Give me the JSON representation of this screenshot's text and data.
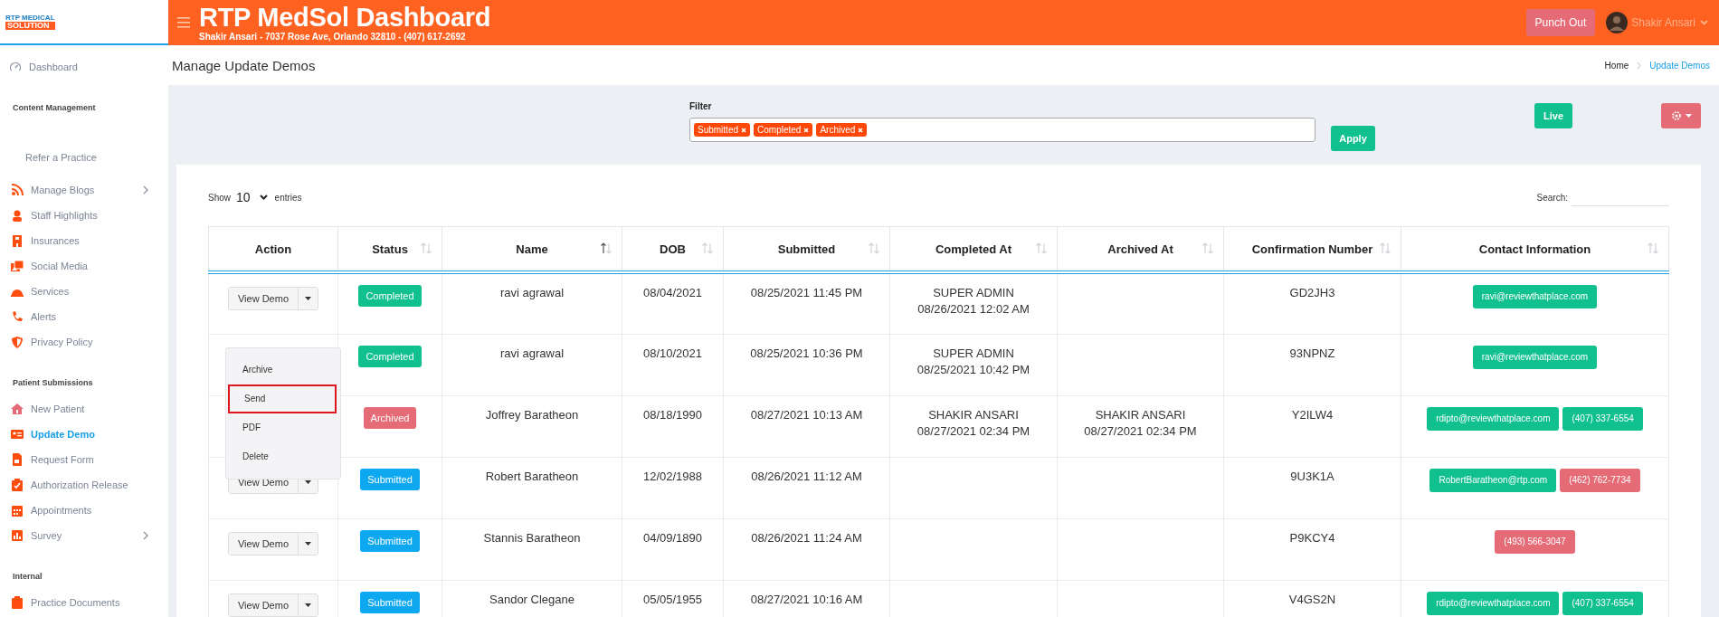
{
  "logo": {
    "line1": "RTP MEDICAL",
    "line2": "SOLUTION"
  },
  "header": {
    "title": "RTP MedSol Dashboard",
    "subtitle": "Shakir Ansari - 7037 Rose Ave, Orlando 32810 - (407) 617-2692",
    "punch_button": "Punch Out",
    "user_name": "Shakir Ansari"
  },
  "sidebar": {
    "sections": [
      {
        "items": [
          {
            "label": "Dashboard",
            "kind": "top",
            "selected": false,
            "has_submenu": false
          }
        ]
      },
      {
        "title": "Content Management",
        "items": [
          {
            "label": "Refer a Practice",
            "kind": "plain",
            "selected": false,
            "has_submenu": false
          },
          {
            "label": "Manage Blogs",
            "kind": "icon",
            "selected": false,
            "has_submenu": true
          },
          {
            "label": "Staff Highlights",
            "kind": "icon",
            "selected": false,
            "has_submenu": false
          },
          {
            "label": "Insurances",
            "kind": "icon",
            "selected": false,
            "has_submenu": false
          },
          {
            "label": "Social Media",
            "kind": "icon",
            "selected": false,
            "has_submenu": false
          },
          {
            "label": "Services",
            "kind": "icon",
            "selected": false,
            "has_submenu": false
          },
          {
            "label": "Alerts",
            "kind": "icon",
            "selected": false,
            "has_submenu": false
          },
          {
            "label": "Privacy Policy",
            "kind": "icon",
            "selected": false,
            "has_submenu": false
          }
        ]
      },
      {
        "title": "Patient Submissions",
        "items": [
          {
            "label": "New Patient",
            "kind": "icon",
            "selected": false,
            "has_submenu": false
          },
          {
            "label": "Update Demo",
            "kind": "icon",
            "selected": true,
            "has_submenu": false
          },
          {
            "label": "Request Form",
            "kind": "icon",
            "selected": false,
            "has_submenu": false
          },
          {
            "label": "Authorization Release",
            "kind": "icon",
            "selected": false,
            "has_submenu": false
          },
          {
            "label": "Appointments",
            "kind": "icon",
            "selected": false,
            "has_submenu": false
          },
          {
            "label": "Survey",
            "kind": "icon",
            "selected": false,
            "has_submenu": true
          }
        ]
      },
      {
        "title": "Internal",
        "items": [
          {
            "label": "Practice Documents",
            "kind": "icon",
            "selected": false,
            "has_submenu": false
          }
        ]
      }
    ]
  },
  "page": {
    "title": "Manage Update Demos",
    "breadcrumb": [
      {
        "label": "Home",
        "selected": false
      },
      {
        "label": "Update Demos",
        "selected": true
      }
    ]
  },
  "filter": {
    "label": "Filter",
    "tags": [
      "Submitted",
      "Completed",
      "Archived"
    ],
    "apply_button": "Apply",
    "live_button": "Live"
  },
  "table_controls": {
    "show_label": "Show",
    "page_size": "10",
    "entries_label": "entries",
    "search_label": "Search:"
  },
  "table": {
    "columns": [
      {
        "label": "Action",
        "sortable": false
      },
      {
        "label": "Status",
        "sortable": true,
        "sorted": false
      },
      {
        "label": "Name",
        "sortable": true,
        "sorted": true
      },
      {
        "label": "DOB",
        "sortable": true,
        "sorted": false
      },
      {
        "label": "Submitted",
        "sortable": true,
        "sorted": false
      },
      {
        "label": "Completed At",
        "sortable": true,
        "sorted": false
      },
      {
        "label": "Archived At",
        "sortable": true,
        "sorted": false
      },
      {
        "label": "Confirmation Number",
        "sortable": true,
        "sorted": false
      },
      {
        "label": "Contact Information",
        "sortable": true,
        "sorted": false
      }
    ],
    "rows": [
      {
        "action": {
          "button": "View Demo"
        },
        "status": {
          "label": "Completed",
          "kind": "completed"
        },
        "name": "ravi agrawal",
        "dob": "08/04/2021",
        "submitted": "08/25/2021 11:45 PM",
        "completed_at": [
          "SUPER ADMIN",
          "08/26/2021 12:02 AM"
        ],
        "confirmation": "GD2JH3",
        "contacts": [
          {
            "text": "ravi@reviewthatplace.com",
            "color": "#10c08e"
          }
        ]
      },
      {
        "action": {
          "menu": [
            {
              "label": "Archive",
              "highlighted": false
            },
            {
              "label": "Send",
              "highlighted": true
            },
            {
              "label": "PDF",
              "highlighted": false
            },
            {
              "label": "Delete",
              "highlighted": false
            }
          ]
        },
        "status": {
          "label": "Completed",
          "kind": "completed"
        },
        "name": "ravi agrawal",
        "dob": "08/10/2021",
        "submitted": "08/25/2021 10:36 PM",
        "completed_at": [
          "SUPER ADMIN",
          "08/25/2021 10:42 PM"
        ],
        "confirmation": "93NPNZ",
        "contacts": [
          {
            "text": "ravi@reviewthatplace.com",
            "color": "#10c08e"
          }
        ]
      },
      {
        "status": {
          "label": "Archived",
          "kind": "archived"
        },
        "name": "Joffrey Baratheon",
        "dob": "08/18/1990",
        "submitted": "08/27/2021 10:13 AM",
        "completed_at": [
          "SHAKIR ANSARI",
          "08/27/2021 02:34 PM"
        ],
        "archived_at": [
          "SHAKIR ANSARI",
          "08/27/2021 02:34 PM"
        ],
        "confirmation": "Y2ILW4",
        "contacts": [
          {
            "text": "rdipto@reviewthatplace.com",
            "color": "#10c08e"
          },
          {
            "text": "(407) 337-6554",
            "color": "#10c08e"
          }
        ]
      },
      {
        "action": {
          "button": "View Demo"
        },
        "status": {
          "label": "Submitted",
          "kind": "submitted"
        },
        "name": "Robert Baratheon",
        "dob": "12/02/1988",
        "submitted": "08/26/2021 11:12 AM",
        "confirmation": "9U3K1A",
        "contacts": [
          {
            "text": "RobertBaratheon@rtp.com",
            "color": "#10c08e"
          },
          {
            "text": "(462) 762-7734",
            "color": "#e56b76"
          }
        ]
      },
      {
        "action": {
          "button": "View Demo"
        },
        "status": {
          "label": "Submitted",
          "kind": "submitted"
        },
        "name": "Stannis Baratheon",
        "dob": "04/09/1890",
        "submitted": "08/26/2021 11:24 AM",
        "confirmation": "P9KCY4",
        "contacts": [
          {
            "text": "(493) 566-3047",
            "color": "#e56b76"
          }
        ]
      },
      {
        "action": {
          "button": "View Demo"
        },
        "status": {
          "label": "Submitted",
          "kind": "submitted"
        },
        "name": "Sandor Clegane",
        "dob": "05/05/1955",
        "submitted": "08/27/2021 10:16 AM",
        "confirmation": "V4GS2N",
        "contacts": [
          {
            "text": "rdipto@reviewthatplace.com",
            "color": "#10c08e"
          },
          {
            "text": "(407) 337-6554",
            "color": "#10c08e"
          }
        ]
      }
    ]
  }
}
